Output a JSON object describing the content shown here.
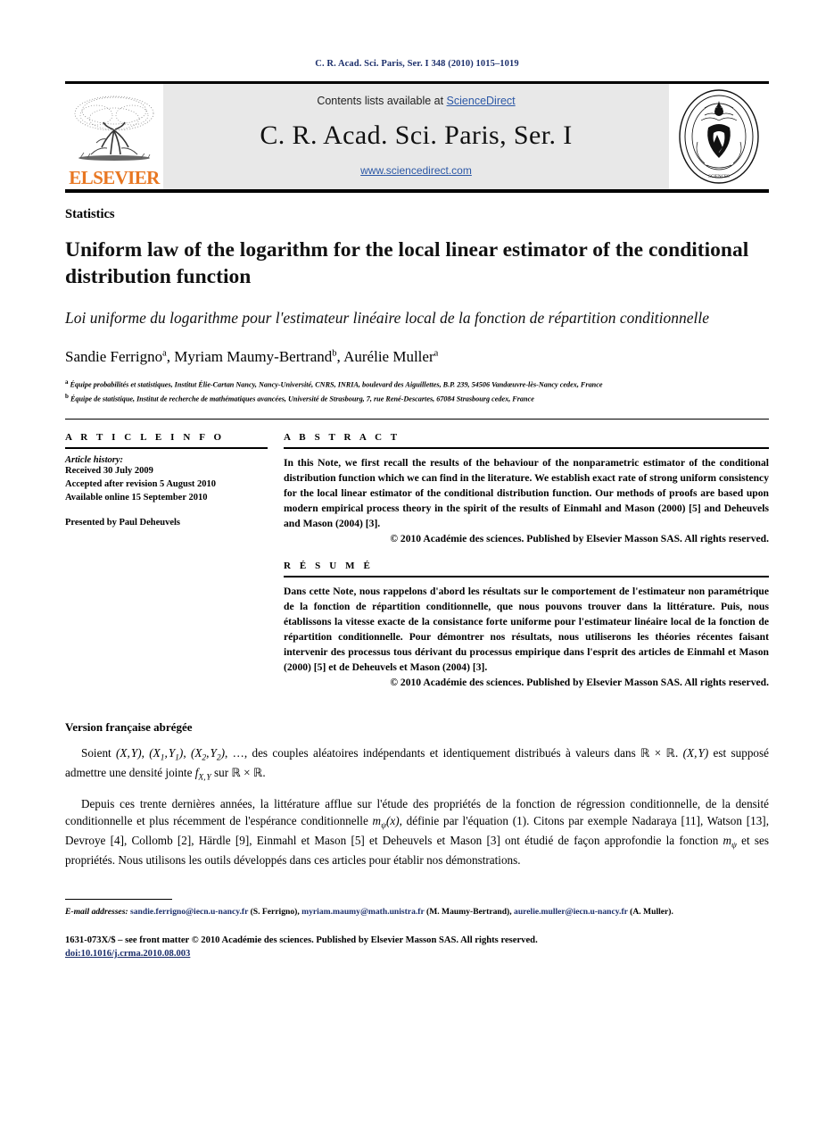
{
  "running_head": "C. R. Acad. Sci. Paris, Ser. I 348 (2010) 1015–1019",
  "banner": {
    "publisher_name": "ELSEVIER",
    "contents_prefix": "Contents lists available at ",
    "sciencedirect_link": "ScienceDirect",
    "journal_title": "C. R. Acad. Sci. Paris, Ser. I",
    "url": "www.sciencedirect.com"
  },
  "colors": {
    "link_blue": "#2c58a6",
    "head_blue": "#1c2f6b",
    "elsevier_orange": "#E87722",
    "banner_grey": "#e8e8e8"
  },
  "subject": "Statistics",
  "title_en": "Uniform law of the logarithm for the local linear estimator of the conditional distribution function",
  "title_fr": "Loi uniforme du logarithme pour l'estimateur linéaire local de la fonction de répartition conditionnelle",
  "authors": [
    {
      "name": "Sandie Ferrigno",
      "mark": "a"
    },
    {
      "name": "Myriam Maumy-Bertrand",
      "mark": "b"
    },
    {
      "name": "Aurélie Muller",
      "mark": "a"
    }
  ],
  "affiliations": [
    {
      "mark": "a",
      "text": "Équipe probabilités et statistiques, Institut Élie-Cartan Nancy, Nancy-Université, CNRS, INRIA, boulevard des Aiguillettes, B.P. 239, 54506 Vandœuvre-lès-Nancy cedex, France"
    },
    {
      "mark": "b",
      "text": "Équipe de statistique, Institut de recherche de mathématiques avancées, Université de Strasbourg, 7, rue René-Descartes, 67084 Strasbourg cedex, France"
    }
  ],
  "article_info": {
    "heading": "A R T I C L E  I N F O",
    "history_label": "Article history:",
    "history": [
      "Received 30 July 2009",
      "Accepted after revision 5 August 2010",
      "Available online 15 September 2010"
    ],
    "presented_by": "Presented by Paul Deheuvels"
  },
  "abstract": {
    "heading": "A B S T R A C T",
    "body": "In this Note, we first recall the results of the behaviour of the nonparametric estimator of the conditional distribution function which we can find in the literature. We establish exact rate of strong uniform consistency for the local linear estimator of the conditional distribution function. Our methods of proofs are based upon modern empirical process theory in the spirit of the results of Einmahl and Mason (2000) [5] and Deheuvels and Mason (2004) [3].",
    "copyright": "© 2010 Académie des sciences. Published by Elsevier Masson SAS. All rights reserved."
  },
  "resume": {
    "heading": "R É S U M É",
    "body": "Dans cette Note, nous rappelons d'abord les résultats sur le comportement de l'estimateur non paramétrique de la fonction de répartition conditionnelle, que nous pouvons trouver dans la littérature. Puis, nous établissons la vitesse exacte de la consistance forte uniforme pour l'estimateur linéaire local de la fonction de répartition conditionnelle. Pour démontrer nos résultats, nous utiliserons les théories récentes faisant intervenir des processus tous dérivant du processus empirique dans l'esprit des articles de Einmahl et Mason (2000) [5] et de Deheuvels et Mason (2004) [3].",
    "copyright": "© 2010 Académie des sciences. Published by Elsevier Masson SAS. All rights reserved."
  },
  "french_version": {
    "heading": "Version française abrégée",
    "paragraph_1_a": "Soient ",
    "paragraph_1_b": ", des couples aléatoires indépendants et identiquement distribués à valeurs dans ",
    "paragraph_1_c": " est supposé admettre une densité jointe ",
    "paragraph_1_d": " sur ",
    "paragraph_2_a": "Depuis ces trente dernières années, la littérature afflue sur l'étude des propriétés de la fonction de régression conditionnelle, de la densité conditionnelle et plus récemment de l'espérance conditionnelle ",
    "paragraph_2_b": ", définie par l'équation (1). Citons par exemple Nadaraya [11], Watson [13], Devroye [4], Collomb [2], Härdle [9], Einmahl et Mason [5] et Deheuvels et Mason [3] ont étudié de façon approfondie la fonction ",
    "paragraph_2_c": " et ses propriétés. Nous utilisons les outils développés dans ces articles pour établir nos démonstrations."
  },
  "footnote": {
    "label": "E-mail addresses:",
    "emails": [
      {
        "address": "sandie.ferrigno@iecn.u-nancy.fr",
        "owner": "(S. Ferrigno)"
      },
      {
        "address": "myriam.maumy@math.unistra.fr",
        "owner": "(M. Maumy-Bertrand)"
      },
      {
        "address": "aurelie.muller@iecn.u-nancy.fr",
        "owner": "(A. Muller)"
      }
    ]
  },
  "imprint": {
    "line1": "1631-073X/$ – see front matter © 2010 Académie des sciences. Published by Elsevier Masson SAS. All rights reserved.",
    "doi": "doi:10.1016/j.crma.2010.08.003"
  }
}
